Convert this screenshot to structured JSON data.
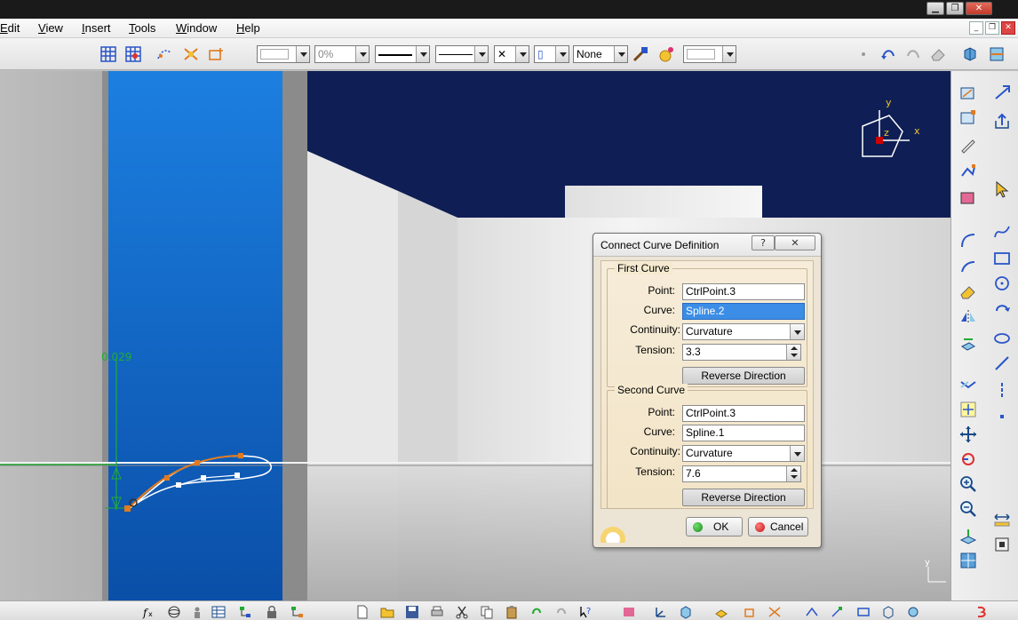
{
  "menu": {
    "items": [
      {
        "label": "Edit",
        "underline": "E",
        "rest": "dit"
      },
      {
        "label": "View",
        "underline": "V",
        "rest": "iew"
      },
      {
        "label": "Insert",
        "underline": "I",
        "rest": "nsert"
      },
      {
        "label": "Tools",
        "underline": "T",
        "rest": "ools"
      },
      {
        "label": "Window",
        "underline": "W",
        "rest": "indow"
      },
      {
        "label": "Help",
        "underline": "H",
        "rest": "elp"
      }
    ]
  },
  "toolbar": {
    "transparency_value": "0%",
    "layer_value": "None"
  },
  "viewport": {
    "dimension_label": "0.029",
    "compass_labels": {
      "y": "y",
      "z": "z",
      "x": "x"
    },
    "mini_axis_label": "y"
  },
  "dialog": {
    "title": "Connect Curve Definition",
    "help_label": "?",
    "close_label": "✕",
    "first_curve": {
      "group_label": "First Curve",
      "point_label": "Point:",
      "point_value": "CtrlPoint.3",
      "curve_label": "Curve:",
      "curve_value": "Spline.2",
      "continuity_label": "Continuity:",
      "continuity_value": "Curvature",
      "tension_label": "Tension:",
      "tension_value": "3.3",
      "reverse_label": "Reverse Direction"
    },
    "second_curve": {
      "group_label": "Second Curve",
      "point_label": "Point:",
      "point_value": "CtrlPoint.3",
      "curve_label": "Curve:",
      "curve_value": "Spline.1",
      "continuity_label": "Continuity:",
      "continuity_value": "Curvature",
      "tension_label": "Tension:",
      "tension_value": "7.6",
      "reverse_label": "Reverse Direction"
    },
    "ok_label": "OK",
    "cancel_label": "Cancel"
  },
  "colors": {
    "accent_blue": "#1565c0",
    "sky_navy": "#0f1f55",
    "selection_blue": "#3b8de6",
    "dimension_green": "#22aa33",
    "spline_orange": "#e07b20"
  }
}
